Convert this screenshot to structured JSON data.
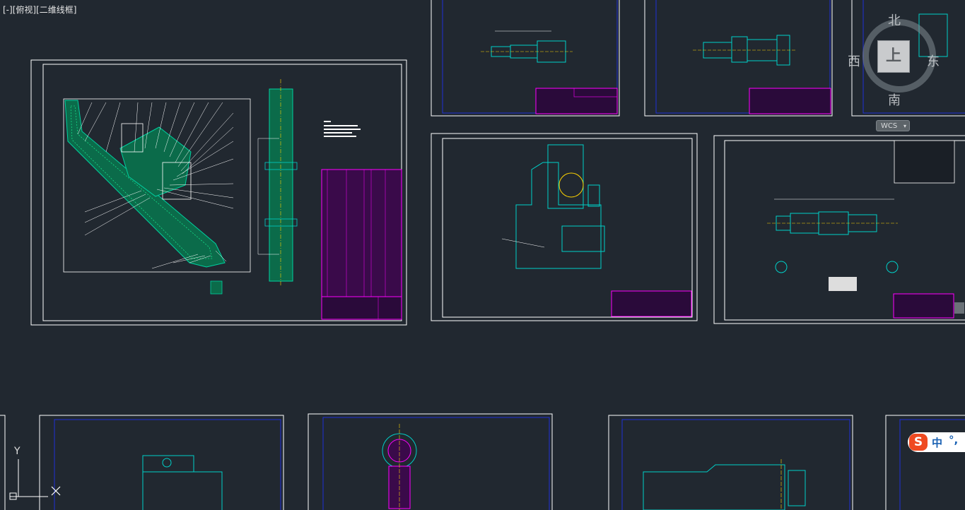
{
  "viewport": {
    "label": "[-][俯视][二维线框]"
  },
  "viewcube": {
    "north": "北",
    "south": "南",
    "west": "西",
    "east": "东",
    "face": "上",
    "wcs_label": "WCS",
    "wcs_caret": "▾"
  },
  "ucs": {
    "y_label": "Y"
  },
  "ime": {
    "logo": "S",
    "mode": "中",
    "punct": "°,"
  },
  "colors": {
    "background": "#212830",
    "frame": "#ffffff",
    "inner_frame": "#1f2fd6",
    "drawing": "#00d0c8",
    "hatch": "#00c47a",
    "title_block": "#ff00ff",
    "center_line": "#ffd400",
    "red_text": "#ff2020"
  }
}
